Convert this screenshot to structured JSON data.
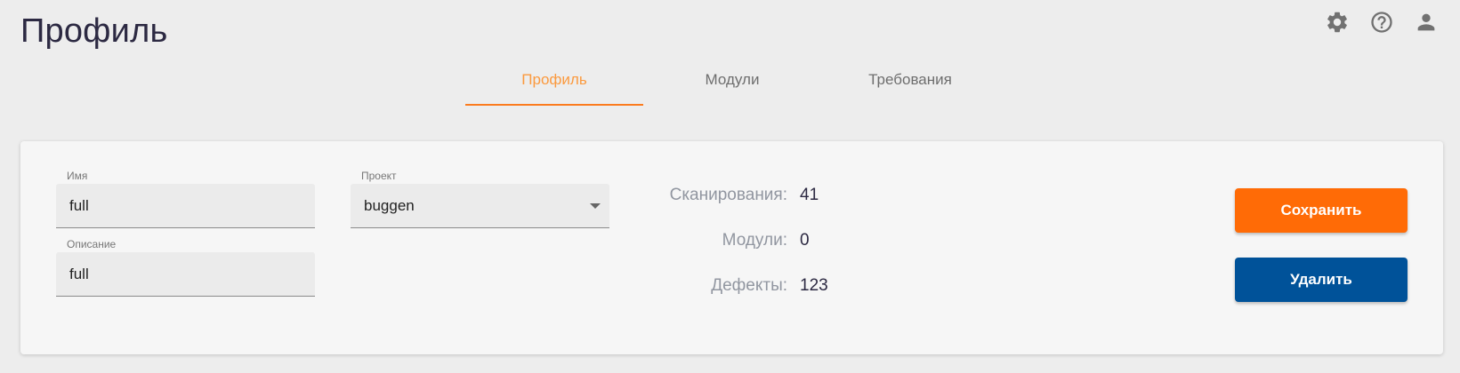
{
  "page": {
    "title": "Профиль"
  },
  "header_icons": [
    "gear-icon",
    "help-icon",
    "user-icon"
  ],
  "tabs": [
    {
      "label": "Профиль",
      "active": true
    },
    {
      "label": "Модули",
      "active": false
    },
    {
      "label": "Требования",
      "active": false
    }
  ],
  "form": {
    "name": {
      "label": "Имя",
      "value": "full"
    },
    "description": {
      "label": "Описание",
      "value": "full"
    },
    "project": {
      "label": "Проект",
      "value": "buggen"
    }
  },
  "stats": [
    {
      "label": "Сканирования:",
      "value": "41"
    },
    {
      "label": "Модули:",
      "value": "0"
    },
    {
      "label": "Дефекты:",
      "value": "123"
    }
  ],
  "buttons": {
    "save": "Сохранить",
    "delete": "Удалить"
  },
  "colors": {
    "accent": "#ff6b06",
    "active_tab": "#fb9a3f",
    "delete": "#005299",
    "title": "#2c2942"
  }
}
